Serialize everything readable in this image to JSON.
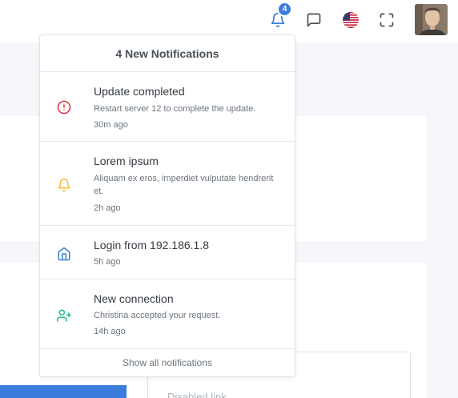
{
  "navbar": {
    "notification_count": "4",
    "icons": {
      "bell": "bell-icon",
      "messages": "message-square-icon",
      "language": "us-flag-icon",
      "fullscreen": "maximize-icon",
      "avatar": "user-avatar"
    }
  },
  "notifications": {
    "header": "4 New Notifications",
    "items": [
      {
        "title": "Update completed",
        "description": "Restart server 12 to complete the update.",
        "time": "30m ago",
        "icon": "alert-circle-icon",
        "color": "#dc3545"
      },
      {
        "title": "Lorem ipsum",
        "description": "Aliquam ex eros, imperdiet vulputate hendrerit et.",
        "time": "2h ago",
        "icon": "bell-icon",
        "color": "#fcb92c"
      },
      {
        "title": "Login from 192.186.1.8",
        "description": "",
        "time": "5h ago",
        "icon": "home-icon",
        "color": "#3b7ddd"
      },
      {
        "title": "New connection",
        "description": "Christina accepted your request.",
        "time": "14h ago",
        "icon": "user-plus-icon",
        "color": "#1cbb8c"
      }
    ],
    "footer": "Show all notifications"
  },
  "background": {
    "disabled_link": "Disabled link"
  },
  "colors": {
    "accent": "#3b7ddd",
    "danger": "#dc3545",
    "warning": "#fcb92c",
    "success": "#1cbb8c"
  }
}
